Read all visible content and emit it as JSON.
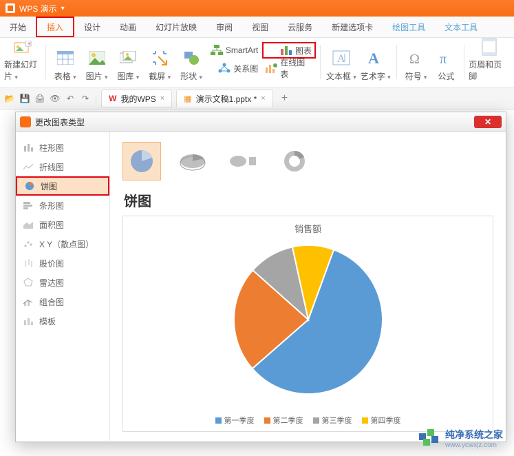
{
  "app": {
    "title": "WPS 演示"
  },
  "menu": {
    "tabs": [
      "开始",
      "插入",
      "设计",
      "动画",
      "幻灯片放映",
      "审阅",
      "视图",
      "云服务",
      "新建选项卡",
      "绘图工具",
      "文本工具"
    ],
    "active_index": 1
  },
  "ribbon": {
    "new_slide": "新建幻灯片",
    "table": "表格",
    "picture": "图片",
    "gallery": "图库",
    "screenshot": "截屏",
    "shapes": "形状",
    "smartart": "SmartArt",
    "chart": "图表",
    "relation": "关系图",
    "online_chart": "在线图表",
    "textbox": "文本框",
    "wordart": "艺术字",
    "symbol": "符号",
    "equation": "公式",
    "header_footer": "页眉和页脚"
  },
  "doc_tabs": {
    "wps_home": "我的WPS",
    "file": "演示文稿1.pptx *"
  },
  "dialog": {
    "title": "更改图表类型",
    "categories": [
      "柱形图",
      "折线图",
      "饼图",
      "条形图",
      "面积图",
      "X Y（散点图）",
      "股价图",
      "雷达图",
      "组合图",
      "模板"
    ],
    "selected_index": 2,
    "preview_title": "饼图"
  },
  "chart_data": {
    "type": "pie",
    "title": "销售额",
    "categories": [
      "第一季度",
      "第二季度",
      "第三季度",
      "第四季度"
    ],
    "values": [
      58,
      23,
      10,
      9
    ],
    "colors": [
      "#5b9bd5",
      "#ed7d31",
      "#a5a5a5",
      "#ffc000"
    ]
  },
  "watermark": {
    "name": "纯净系统之家",
    "url": "www.ycwxjz.com"
  }
}
